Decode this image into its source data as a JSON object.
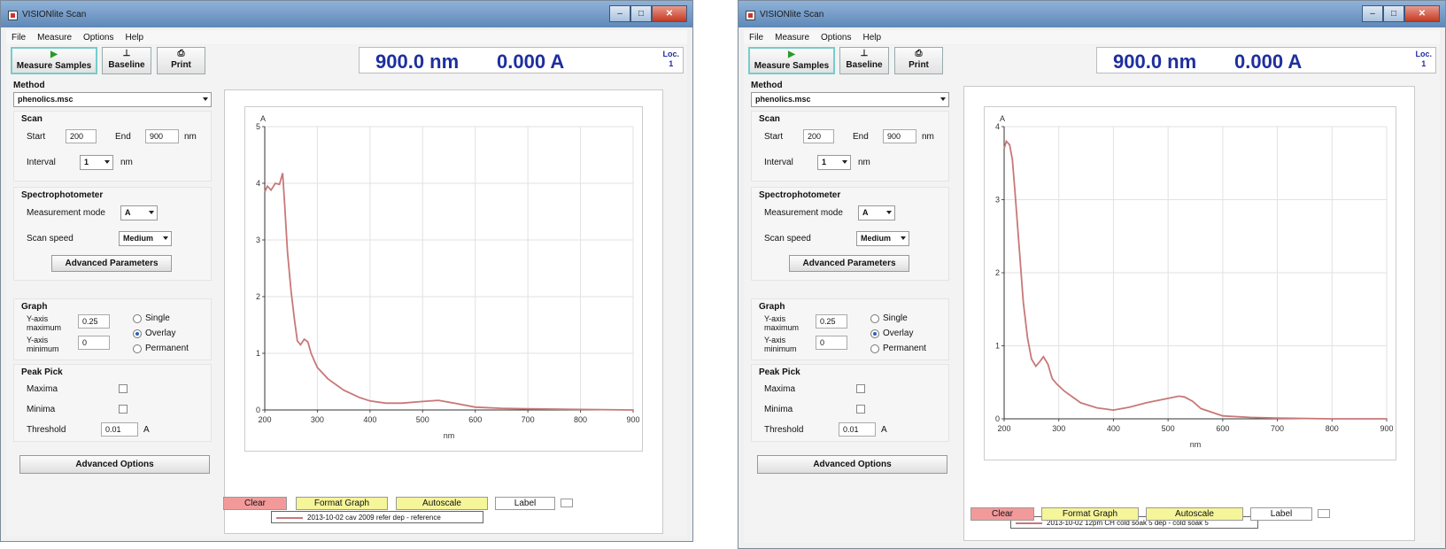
{
  "windows": [
    {
      "title": "VISIONlite Scan",
      "menu": [
        "File",
        "Measure",
        "Options",
        "Help"
      ],
      "toolbar": {
        "measure": "Measure Samples",
        "baseline": "Baseline",
        "print": "Print"
      },
      "readout": {
        "wavelength": "900.0 nm",
        "absorbance": "0.000 A",
        "loc_label": "Loc.",
        "loc_value": "1"
      },
      "method": {
        "label": "Method",
        "value": "phenolics.msc"
      },
      "scan": {
        "label": "Scan",
        "start_label": "Start",
        "start": "200",
        "end_label": "End",
        "end": "900",
        "unit": "nm",
        "interval_label": "Interval",
        "interval": "1",
        "interval_unit": "nm"
      },
      "spectro": {
        "label": "Spectrophotometer",
        "mode_label": "Measurement mode",
        "mode": "A",
        "speed_label": "Scan speed",
        "speed": "Medium",
        "advanced": "Advanced Parameters"
      },
      "graph": {
        "label": "Graph",
        "ymax_label": "Y-axis maximum",
        "ymax": "0.25",
        "ymin_label": "Y-axis minimum",
        "ymin": "0",
        "single": "Single",
        "overlay": "Overlay",
        "permanent": "Permanent",
        "selected": "Overlay"
      },
      "peak": {
        "label": "Peak Pick",
        "maxima": "Maxima",
        "minima": "Minima",
        "threshold_label": "Threshold",
        "threshold": "0.01",
        "threshold_unit": "A"
      },
      "advanced_options": "Advanced Options",
      "bottom": {
        "clear": "Clear",
        "format": "Format Graph",
        "autoscale": "Autoscale",
        "label": "Label"
      },
      "chart_data": {
        "type": "line",
        "xlabel": "nm",
        "ylabel": "A",
        "xlim": [
          200,
          900
        ],
        "ylim": [
          0,
          5
        ],
        "xticks": [
          "200",
          "300",
          "400",
          "500",
          "600",
          "700",
          "800",
          "900"
        ],
        "yticks": [
          "0",
          "1",
          "2",
          "3",
          "4",
          "5"
        ],
        "grid": true,
        "legend_position": "bottom",
        "series": [
          {
            "name": "2013-10-02 cav 2009 refer dep - reference",
            "color": "#c87878",
            "x": [
              200,
              205,
              212,
              220,
              228,
              234,
              238,
              243,
              250,
              257,
              262,
              268,
              275,
              282,
              288,
              295,
              300,
              320,
              350,
              380,
              400,
              430,
              460,
              500,
              530,
              560,
              600,
              650,
              700,
              800,
              900
            ],
            "y": [
              3.85,
              3.95,
              3.88,
              4.0,
              3.98,
              4.18,
              3.6,
              2.8,
              2.1,
              1.55,
              1.22,
              1.15,
              1.25,
              1.2,
              1.0,
              0.85,
              0.75,
              0.55,
              0.35,
              0.22,
              0.16,
              0.12,
              0.12,
              0.15,
              0.17,
              0.12,
              0.05,
              0.03,
              0.02,
              0.01,
              0.0
            ]
          }
        ]
      }
    },
    {
      "title": "VISIONlite Scan",
      "menu": [
        "File",
        "Measure",
        "Options",
        "Help"
      ],
      "toolbar": {
        "measure": "Measure Samples",
        "baseline": "Baseline",
        "print": "Print"
      },
      "readout": {
        "wavelength": "900.0 nm",
        "absorbance": "0.000 A",
        "loc_label": "Loc.",
        "loc_value": "1"
      },
      "method": {
        "label": "Method",
        "value": "phenolics.msc"
      },
      "scan": {
        "label": "Scan",
        "start_label": "Start",
        "start": "200",
        "end_label": "End",
        "end": "900",
        "unit": "nm",
        "interval_label": "Interval",
        "interval": "1",
        "interval_unit": "nm"
      },
      "spectro": {
        "label": "Spectrophotometer",
        "mode_label": "Measurement mode",
        "mode": "A",
        "speed_label": "Scan speed",
        "speed": "Medium",
        "advanced": "Advanced Parameters"
      },
      "graph": {
        "label": "Graph",
        "ymax_label": "Y-axis maximum",
        "ymax": "0.25",
        "ymin_label": "Y-axis minimum",
        "ymin": "0",
        "single": "Single",
        "overlay": "Overlay",
        "permanent": "Permanent",
        "selected": "Overlay"
      },
      "peak": {
        "label": "Peak Pick",
        "maxima": "Maxima",
        "minima": "Minima",
        "threshold_label": "Threshold",
        "threshold": "0.01",
        "threshold_unit": "A"
      },
      "advanced_options": "Advanced Options",
      "bottom": {
        "clear": "Clear",
        "format": "Format Graph",
        "autoscale": "Autoscale",
        "label": "Label"
      },
      "chart_data": {
        "type": "line",
        "xlabel": "nm",
        "ylabel": "A",
        "xlim": [
          200,
          900
        ],
        "ylim": [
          0,
          4
        ],
        "xticks": [
          "200",
          "300",
          "400",
          "500",
          "600",
          "700",
          "800",
          "900"
        ],
        "yticks": [
          "0",
          "1",
          "2",
          "3",
          "4"
        ],
        "grid": true,
        "legend_position": "bottom",
        "series": [
          {
            "name": "2013-10-02 12pm CH cold soak 5 dep - cold soak 5",
            "color": "#c87878",
            "x": [
              200,
              204,
              210,
              215,
              220,
              228,
              235,
              243,
              250,
              258,
              265,
              272,
              280,
              288,
              296,
              310,
              340,
              370,
              400,
              430,
              460,
              500,
              520,
              530,
              545,
              560,
              600,
              650,
              700,
              800,
              900
            ],
            "y": [
              3.7,
              3.8,
              3.75,
              3.55,
              3.1,
              2.3,
              1.6,
              1.1,
              0.82,
              0.72,
              0.78,
              0.85,
              0.75,
              0.55,
              0.48,
              0.38,
              0.22,
              0.15,
              0.12,
              0.16,
              0.22,
              0.28,
              0.31,
              0.3,
              0.24,
              0.14,
              0.04,
              0.02,
              0.01,
              0.0,
              0.0
            ]
          }
        ]
      }
    }
  ]
}
